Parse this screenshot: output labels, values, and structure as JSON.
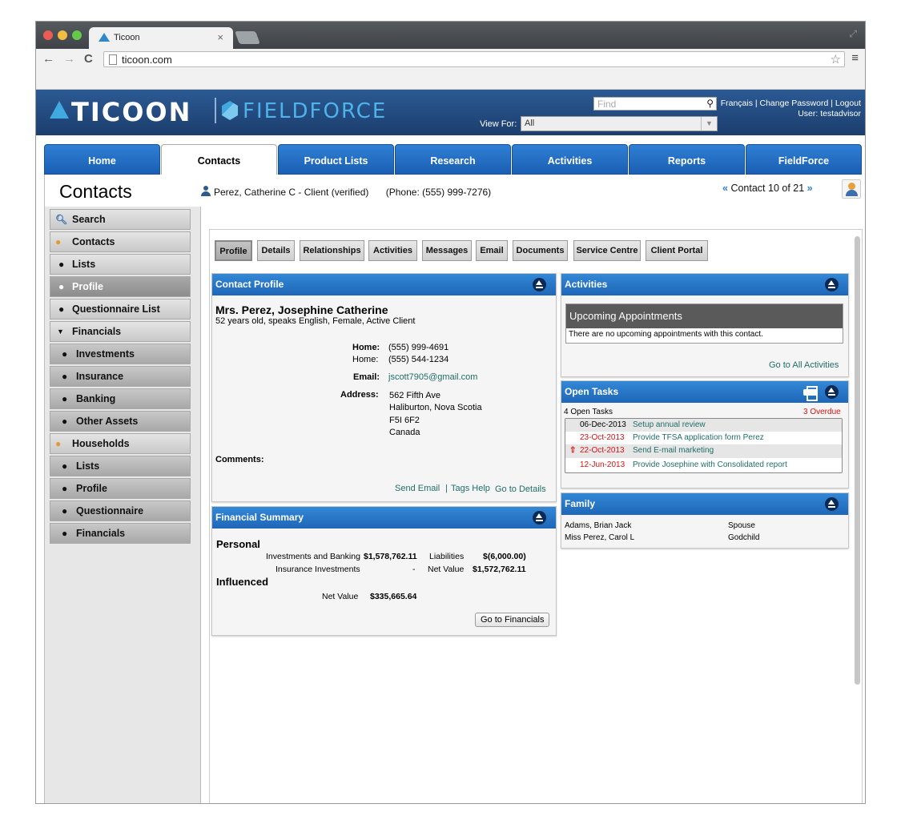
{
  "browser": {
    "tab_title": "Ticoon",
    "tab_close": "×",
    "url": "ticoon.com",
    "nav_back": "←",
    "nav_forward": "→",
    "nav_reload": "C",
    "star": "☆",
    "menu": "≡"
  },
  "header": {
    "logo_main": "TICOON",
    "logo_product": "FIELDFORCE",
    "find_placeholder": "Find",
    "links": "Français | Change Password | Logout",
    "user": "User: testadvisor",
    "view_for_label": "View For:",
    "view_for_value": "All"
  },
  "main_tabs": [
    {
      "label": "Home"
    },
    {
      "label": "Contacts"
    },
    {
      "label": "Product Lists"
    },
    {
      "label": "Research"
    },
    {
      "label": "Activities"
    },
    {
      "label": "Reports"
    },
    {
      "label": "FieldForce"
    }
  ],
  "page_title": "Contacts",
  "sidebar": {
    "items": [
      {
        "label": "Search",
        "icon": "search-icon"
      },
      {
        "label": "Contacts",
        "icon": "person-icon"
      },
      {
        "label": "Lists",
        "icon": "bullet"
      },
      {
        "label": "Profile",
        "icon": "bullet",
        "selected": true
      },
      {
        "label": "Questionnaire List",
        "icon": "bullet"
      },
      {
        "label": "Financials",
        "icon": "caret-down-icon"
      },
      {
        "label": "Investments",
        "icon": "bullet"
      },
      {
        "label": "Insurance",
        "icon": "bullet"
      },
      {
        "label": "Banking",
        "icon": "bullet"
      },
      {
        "label": "Other Assets",
        "icon": "bullet"
      },
      {
        "label": "Households",
        "icon": "group-icon"
      },
      {
        "label": "Lists",
        "icon": "bullet"
      },
      {
        "label": "Profile",
        "icon": "bullet"
      },
      {
        "label": "Questionnaire",
        "icon": "bullet"
      },
      {
        "label": "Financials",
        "icon": "bullet"
      }
    ]
  },
  "contact_header": {
    "name": "Perez, Catherine C - Client (verified)",
    "phone": "(Phone: (555) 999-7276)",
    "nav_text": "Contact 10 of 21",
    "prev": "«",
    "next": "»"
  },
  "sub_tabs": [
    {
      "label": "Profile"
    },
    {
      "label": "Details"
    },
    {
      "label": "Relationships"
    },
    {
      "label": "Activities"
    },
    {
      "label": "Messages"
    },
    {
      "label": "Email"
    },
    {
      "label": "Documents"
    },
    {
      "label": "Service Centre"
    },
    {
      "label": "Client Portal"
    }
  ],
  "contact_profile": {
    "title": "Contact Profile",
    "name": "Mrs. Perez, Josephine Catherine",
    "summary": "52 years old, speaks English, Female, Active Client",
    "home_label_1": "Home:",
    "home_value_1": "(555) 999-4691",
    "home_label_2": "Home:",
    "home_value_2": "(555) 544-1234",
    "email_label": "Email:",
    "email_value": "jscott7905@gmail.com",
    "address_label": "Address:",
    "address_lines": [
      "562 Fifth Ave",
      "Haliburton, Nova Scotia",
      "F5I 6F2",
      "Canada"
    ],
    "comments_label": "Comments:",
    "send_email": "Send Email",
    "sep": "|",
    "tags_help": "Tags Help",
    "go_details": "Go to Details"
  },
  "financial_summary": {
    "title": "Financial Summary",
    "personal_heading": "Personal",
    "inv_bank_label": "Investments and Banking",
    "inv_bank_value": "$1,578,762.11",
    "liabilities_label": "Liabilities",
    "liabilities_value": "$(6,000.00)",
    "ins_inv_label": "Insurance Investments",
    "ins_inv_value": "-",
    "net_value_label": "Net Value",
    "net_value_value": "$1,572,762.11",
    "influenced_heading": "Influenced",
    "inf_net_label": "Net Value",
    "inf_net_value": "$335,665.64",
    "go_financials": "Go to Financials"
  },
  "activities": {
    "title": "Activities",
    "upcoming_title": "Upcoming Appointments",
    "upcoming_empty": "There are no upcoming appointments with this contact.",
    "go_all": "Go to All Activities"
  },
  "open_tasks": {
    "title": "Open Tasks",
    "count_label": "4 Open Tasks",
    "overdue_label": "3 Overdue",
    "tasks": [
      {
        "date": "06-Dec-2013",
        "text": "Setup annual review",
        "overdue": false,
        "flag": ""
      },
      {
        "date": "23-Oct-2013",
        "text": "Provide TFSA application form Perez",
        "overdue": true,
        "flag": ""
      },
      {
        "date": "22-Oct-2013",
        "text": "Send E-mail marketing",
        "overdue": true,
        "flag": "⇧"
      },
      {
        "date": "12-Jun-2013",
        "text": "Provide Josephine with Consolidated report",
        "overdue": true,
        "flag": ""
      }
    ]
  },
  "family": {
    "title": "Family",
    "members": [
      {
        "name": "Adams, Brian Jack",
        "relation": "Spouse"
      },
      {
        "name": "Miss Perez, Carol L",
        "relation": "Godchild"
      }
    ]
  },
  "colors": {
    "accent_blue": "#1e66b8",
    "header_navy": "#1c3e6e",
    "overdue_red": "#dd1111",
    "link_teal": "#1f6e68"
  }
}
